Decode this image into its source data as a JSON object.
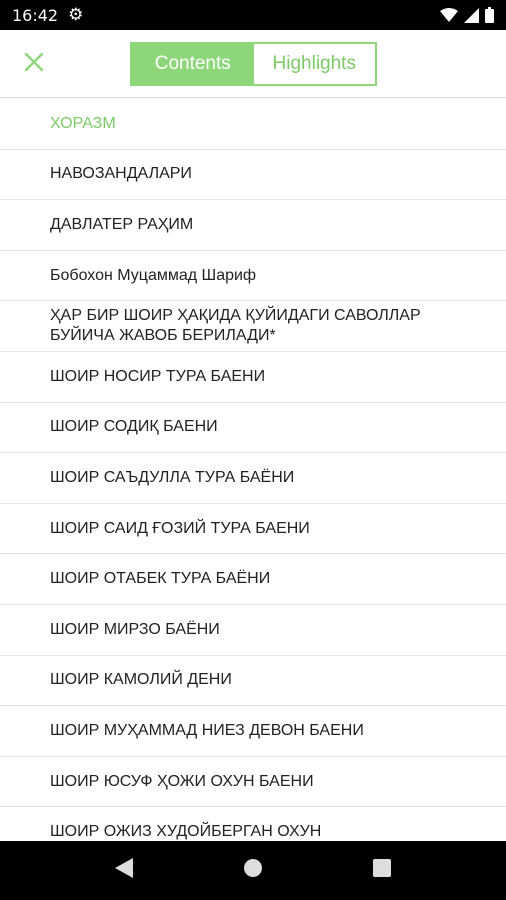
{
  "status_bar": {
    "time": "16:42",
    "icons": [
      "gear-icon",
      "wifi-icon",
      "signal-icon",
      "battery-icon"
    ]
  },
  "toolbar": {
    "close_icon": "close-icon",
    "tabs": [
      {
        "label": "Contents",
        "active": true
      },
      {
        "label": "Highlights",
        "active": false
      }
    ]
  },
  "colors": {
    "accent": "#8ed67a",
    "accent_text": "#7ccc66",
    "text": "#222222",
    "divider": "#e3e3e3"
  },
  "toc": {
    "items": [
      {
        "label": "ХОРАЗМ",
        "current": true
      },
      {
        "label": "НАВОЗАНДАЛАРИ"
      },
      {
        "label": "ДАВЛАТЕР РАҲИМ"
      },
      {
        "label": "Бобохон Муцаммад Шариф"
      },
      {
        "label": "ҲАР БИР ШОИР ҲАҚИДА ҚУЙИДАГИ САВОЛЛАР БУЙИЧА ЖАВОБ БЕРИЛАДИ*"
      },
      {
        "label": "ШОИР НОСИР ТУРА БАЕНИ"
      },
      {
        "label": "ШОИР СОДИҚ БАЕНИ"
      },
      {
        "label": "ШОИР САЪДУЛЛА ТУРА БАЁНИ"
      },
      {
        "label": "ШОИР САИД ҒОЗИЙ ТУРА БАЕНИ"
      },
      {
        "label": "ШОИР ОТАБЕК ТУРА БАЁНИ"
      },
      {
        "label": "ШОИР МИРЗО БАЁНИ"
      },
      {
        "label": "ШОИР КАМОЛИЙ ДЕНИ"
      },
      {
        "label": "ШОИР МУҲАММАД НИЕЗ ДЕВОН БАЕНИ"
      },
      {
        "label": "ШОИР ЮСУФ ҲОЖИ ОХУН БАЕНИ"
      },
      {
        "label": "ШОИР ОЖИЗ ХУДОЙБЕРГАН ОХУН"
      }
    ]
  },
  "nav_bar": {
    "buttons": [
      "back-icon",
      "home-icon",
      "recents-icon"
    ]
  }
}
